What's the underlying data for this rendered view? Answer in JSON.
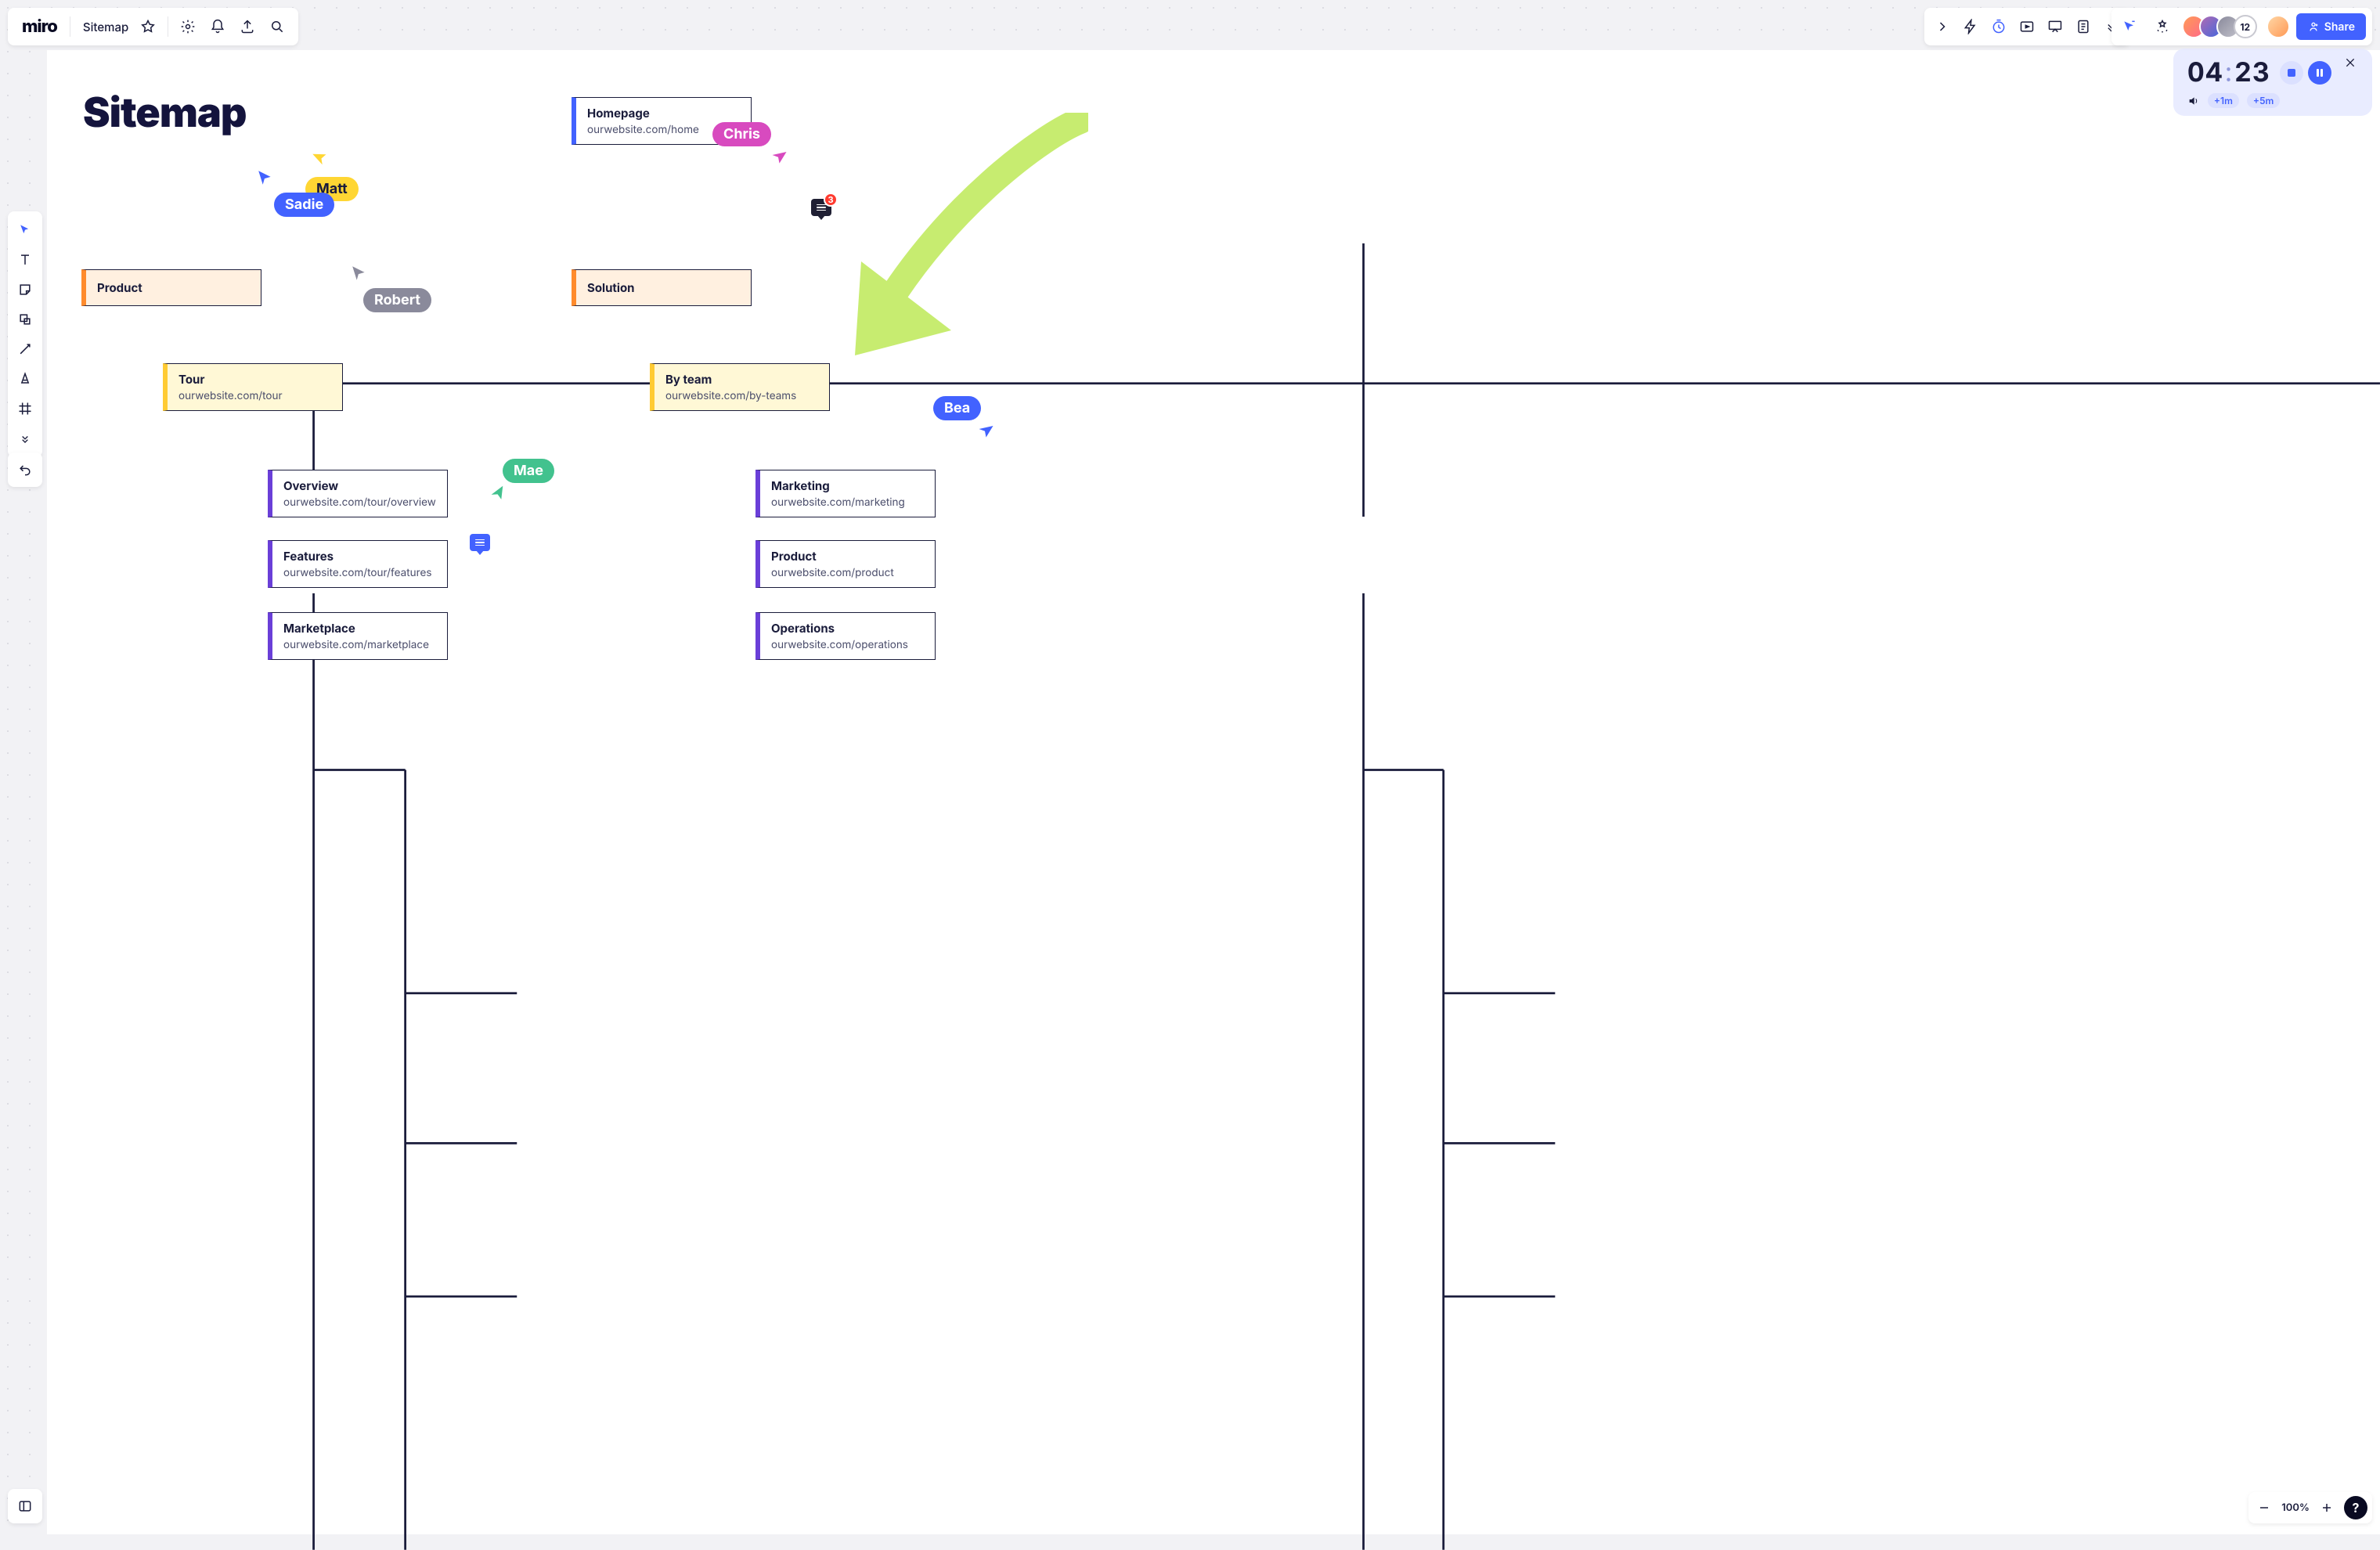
{
  "app": {
    "name": "miro"
  },
  "board": {
    "name": "Sitemap",
    "heading": "Sitemap"
  },
  "topMid": {
    "icons": [
      "lightning",
      "timer",
      "present-slides",
      "present-play",
      "doc-list",
      "chevron-down"
    ]
  },
  "collaborators": {
    "count_label": "12",
    "extra_avatar": true
  },
  "share": {
    "label": "Share"
  },
  "timer": {
    "minutes": "04",
    "seconds": "23",
    "add1": "+1m",
    "add5": "+5m"
  },
  "zoom": {
    "pct": "100%"
  },
  "cards": {
    "homepage": {
      "title": "Homepage",
      "url": "ourwebsite.com/home"
    },
    "product": {
      "title": "Product"
    },
    "solution": {
      "title": "Solution"
    },
    "tour": {
      "title": "Tour",
      "url": "ourwebsite.com/tour"
    },
    "byteam": {
      "title": "By team",
      "url": "ourwebsite.com/by-teams"
    },
    "overview": {
      "title": "Overview",
      "url": "ourwebsite.com/tour/overview"
    },
    "features": {
      "title": "Features",
      "url": "ourwebsite.com/tour/features"
    },
    "marketplace": {
      "title": "Marketplace",
      "url": "ourwebsite.com/marketplace"
    },
    "marketing": {
      "title": "Marketing",
      "url": "ourwebsite.com/marketing"
    },
    "productc": {
      "title": "Product",
      "url": "ourwebsite.com/product"
    },
    "operations": {
      "title": "Operations",
      "url": "ourwebsite.com/operations"
    }
  },
  "cursors": {
    "matt": {
      "label": "Matt"
    },
    "sadie": {
      "label": "Sadie"
    },
    "robert": {
      "label": "Robert"
    },
    "mae": {
      "label": "Mae"
    },
    "chris": {
      "label": "Chris"
    },
    "bea": {
      "label": "Bea"
    }
  },
  "comment_badge": "3",
  "help": {
    "label": "?"
  }
}
